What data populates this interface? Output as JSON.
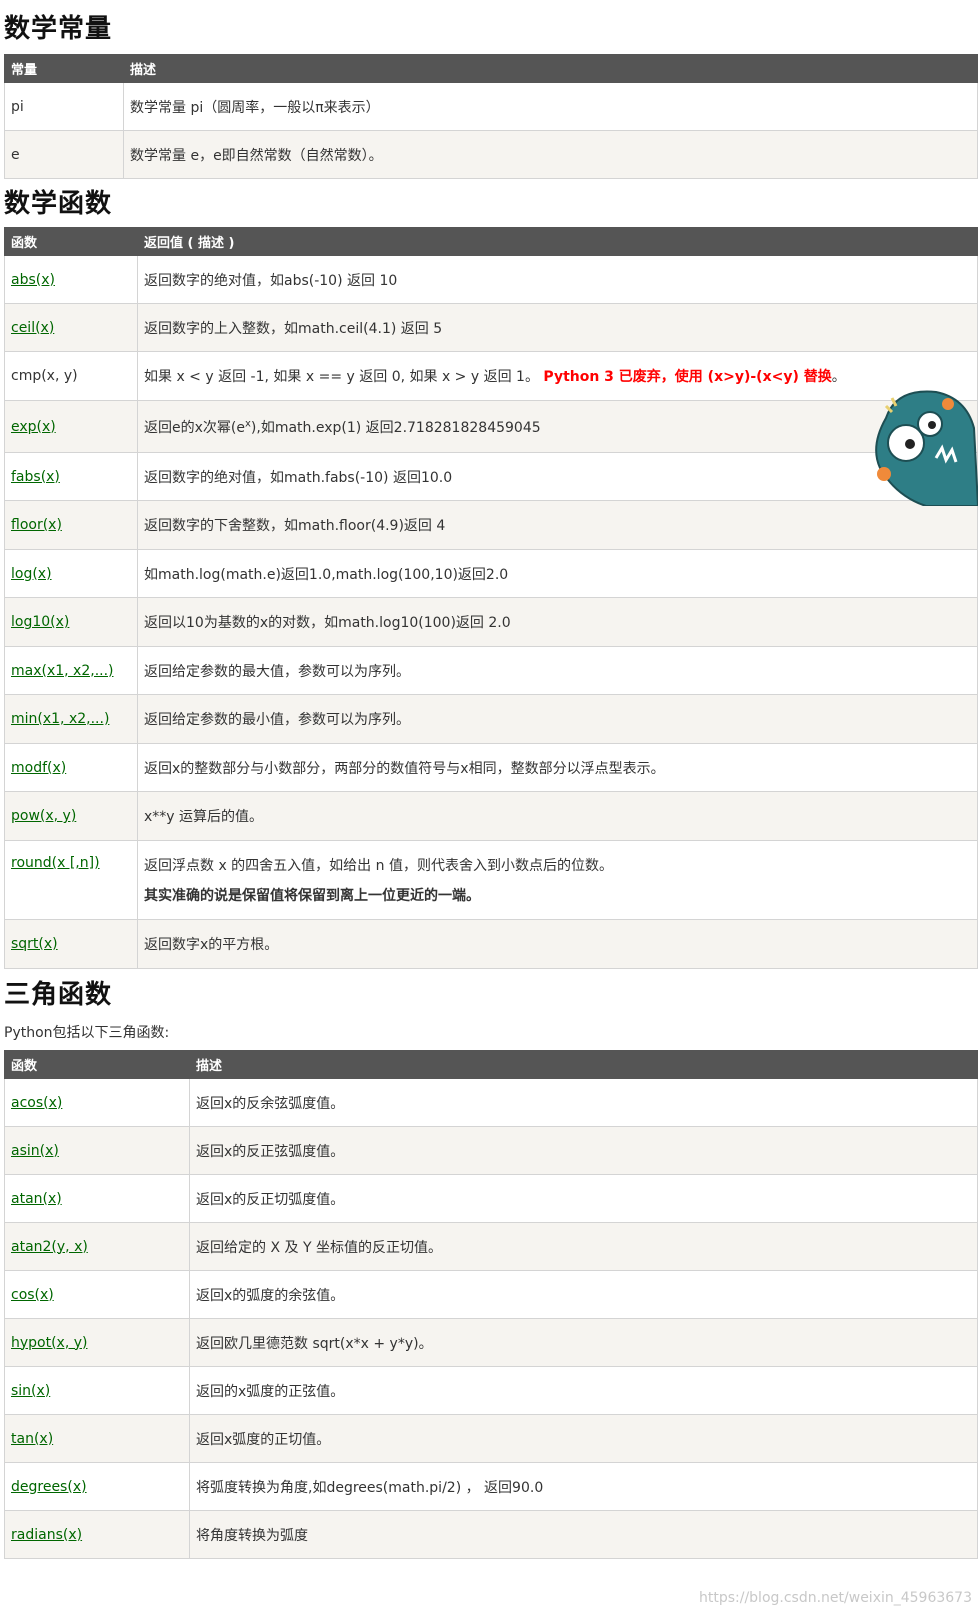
{
  "constants": {
    "heading": "数学常量",
    "col1": "常量",
    "col2": "描述",
    "rows": [
      {
        "name": "pi",
        "desc": "数学常量 pi（圆周率，一般以π来表示）"
      },
      {
        "name": "e",
        "desc": "数学常量 e，e即自然常数（自然常数）。"
      }
    ]
  },
  "math": {
    "heading": "数学函数",
    "col1": "函数",
    "col2": "返回值 ( 描述 )",
    "rows": [
      {
        "name": "abs(x)",
        "desc": "返回数字的绝对值，如abs(-10) 返回 10"
      },
      {
        "name": "ceil(x)",
        "desc": "返回数字的上入整数，如math.ceil(4.1) 返回 5"
      },
      {
        "name": "cmp(x, y)",
        "desc": "如果 x < y 返回 -1, 如果 x == y 返回 0, 如果 x > y 返回 1。 ",
        "note": "Python 3 已废弃，使用 (x>y)-(x<y) 替换",
        "note_tail": "。"
      },
      {
        "name": "exp(x)",
        "desc_pre": "返回e的x次幂(e",
        "desc_sup": "x",
        "desc_post": "),如math.exp(1) 返回2.718281828459045"
      },
      {
        "name": "fabs(x)",
        "desc": "返回数字的绝对值，如math.fabs(-10) 返回10.0"
      },
      {
        "name": "floor(x)",
        "desc": "返回数字的下舍整数，如math.floor(4.9)返回 4"
      },
      {
        "name": "log(x)",
        "desc": "如math.log(math.e)返回1.0,math.log(100,10)返回2.0"
      },
      {
        "name": "log10(x)",
        "desc": "返回以10为基数的x的对数，如math.log10(100)返回 2.0"
      },
      {
        "name": "max(x1, x2,...)",
        "desc": "返回给定参数的最大值，参数可以为序列。"
      },
      {
        "name": "min(x1, x2,...)",
        "desc": "返回给定参数的最小值，参数可以为序列。"
      },
      {
        "name": "modf(x)",
        "desc": "返回x的整数部分与小数部分，两部分的数值符号与x相同，整数部分以浮点型表示。"
      },
      {
        "name": "pow(x, y)",
        "desc": "x**y 运算后的值。"
      },
      {
        "name": "round(x [,n])",
        "desc": "返回浮点数 x 的四舍五入值，如给出 n 值，则代表舍入到小数点后的位数。",
        "desc2": "其实准确的说是保留值将保留到离上一位更近的一端。"
      },
      {
        "name": "sqrt(x)",
        "desc": "返回数字x的平方根。"
      }
    ]
  },
  "trig": {
    "heading": "三角函数",
    "intro": "Python包括以下三角函数:",
    "col1": "函数",
    "col2": "描述",
    "rows": [
      {
        "name": "acos(x)",
        "desc": "返回x的反余弦弧度值。"
      },
      {
        "name": "asin(x)",
        "desc": "返回x的反正弦弧度值。"
      },
      {
        "name": "atan(x)",
        "desc": "返回x的反正切弧度值。"
      },
      {
        "name": "atan2(y, x)",
        "desc": "返回给定的 X 及 Y 坐标值的反正切值。"
      },
      {
        "name": "cos(x)",
        "desc": "返回x的弧度的余弦值。"
      },
      {
        "name": "hypot(x, y)",
        "desc": "返回欧几里德范数 sqrt(x*x + y*y)。"
      },
      {
        "name": "sin(x)",
        "desc": "返回的x弧度的正弦值。"
      },
      {
        "name": "tan(x)",
        "desc": "返回x弧度的正切值。"
      },
      {
        "name": "degrees(x)",
        "desc": "将弧度转换为角度,如degrees(math.pi/2) ，  返回90.0"
      },
      {
        "name": "radians(x)",
        "desc": "将角度转换为弧度"
      }
    ]
  },
  "watermark": "https://blog.csdn.net/weixin_45963673"
}
